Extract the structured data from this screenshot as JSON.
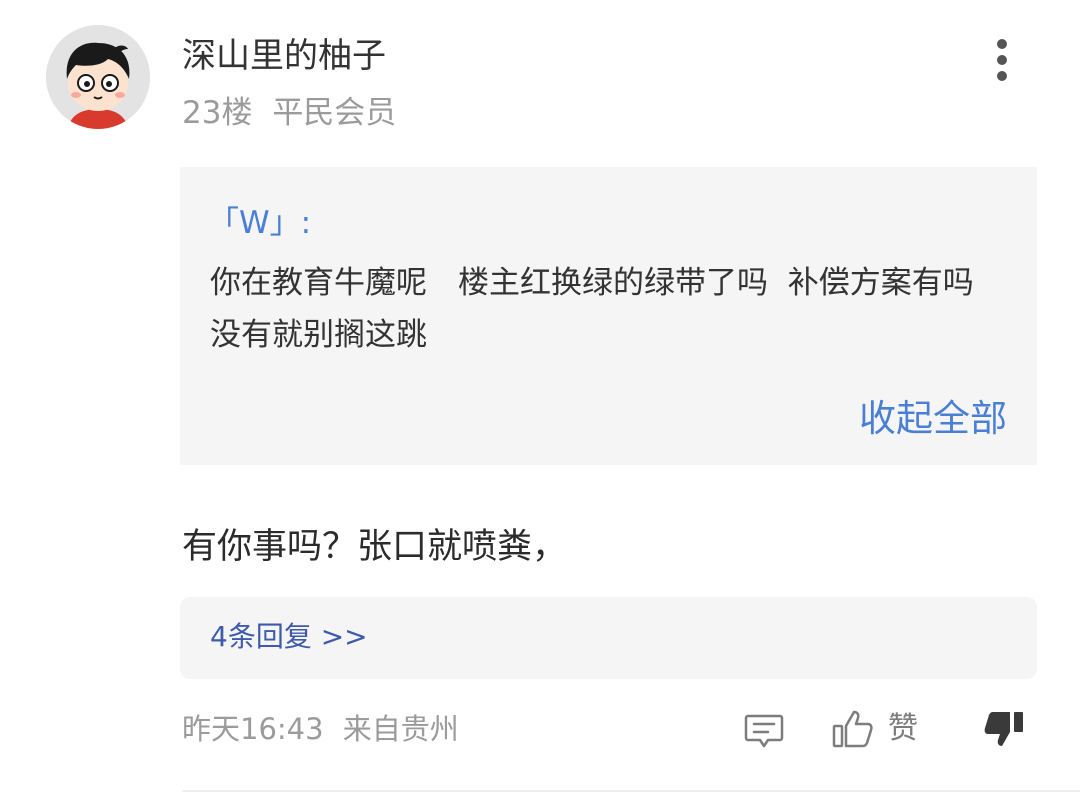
{
  "post": {
    "username": "深山里的柚子",
    "floor": "23楼",
    "member_level": "平民会员"
  },
  "quote": {
    "author": "「W」:",
    "text": "你在教育牛魔呢　楼主红换绿的绿带了吗  补偿方案有吗　没有就别搁这跳",
    "collapse_label": "收起全部"
  },
  "comment": {
    "text": "有你事吗？张口就喷粪，"
  },
  "replies": {
    "label": "4条回复 >>"
  },
  "footer": {
    "time": "昨天16:43",
    "location": "来自贵州",
    "like_label": "赞"
  },
  "icons": {
    "more": "more-vertical-icon",
    "comment": "comment-icon",
    "like": "thumbs-up-icon",
    "dislike": "thumbs-down-icon"
  },
  "colors": {
    "accent": "#4a7fd6",
    "reply_link": "#3e5bab",
    "muted_text": "#9b9b9b",
    "quote_bg": "#f5f5f5"
  }
}
